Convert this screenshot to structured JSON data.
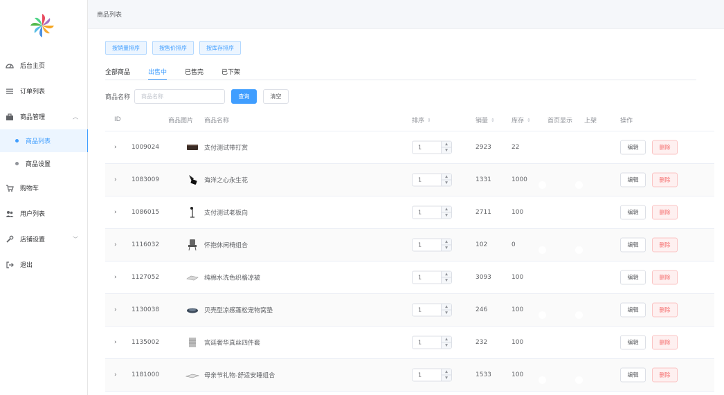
{
  "sidebar": {
    "items": [
      {
        "label": "后台主页",
        "icon": "dashboard-icon"
      },
      {
        "label": "订单列表",
        "icon": "list-icon"
      },
      {
        "label": "商品管理",
        "icon": "shop-icon"
      },
      {
        "label": "购物车",
        "icon": "cart-icon"
      },
      {
        "label": "用户列表",
        "icon": "users-icon"
      },
      {
        "label": "店铺设置",
        "icon": "wrench-icon"
      },
      {
        "label": "退出",
        "icon": "logout-icon"
      }
    ],
    "sub_items": [
      {
        "label": "商品列表",
        "active": true
      },
      {
        "label": "商品设置",
        "active": false
      }
    ]
  },
  "breadcrumb": "商品列表",
  "sort_buttons": [
    "按销量排序",
    "按售价排序",
    "按库存排序"
  ],
  "tabs": [
    "全部商品",
    "出售中",
    "已售完",
    "已下架"
  ],
  "active_tab": "出售中",
  "search": {
    "label": "商品名称",
    "placeholder": "商品名称",
    "query_label": "查询",
    "clear_label": "清空"
  },
  "table": {
    "headers": {
      "id": "ID",
      "image": "商品图片",
      "name": "商品名称",
      "sort": "排序",
      "sales": "销量",
      "stock": "库存",
      "home": "首页显示",
      "onsale": "上架",
      "actions": "操作"
    },
    "edit_label": "编辑",
    "delete_label": "删除",
    "rows": [
      {
        "id": "1009024",
        "name": "支付测试带打赏",
        "sort": "1",
        "sales": "2923",
        "stock": "22",
        "image": "box-image"
      },
      {
        "id": "1083009",
        "name": "海洋之心永生花",
        "sort": "1",
        "sales": "1331",
        "stock": "1000",
        "image": "flower-image"
      },
      {
        "id": "1086015",
        "name": "支付测试老板向",
        "sort": "1",
        "sales": "2711",
        "stock": "100",
        "image": "lamp-image"
      },
      {
        "id": "1116032",
        "name": "怀抱休闲椅组合",
        "sort": "1",
        "sales": "102",
        "stock": "0",
        "image": "chair-image"
      },
      {
        "id": "1127052",
        "name": "纯棉水洗色织格凉被",
        "sort": "1",
        "sales": "3093",
        "stock": "100",
        "image": "quilt-image"
      },
      {
        "id": "1130038",
        "name": "贝壳型凉感蓬松宠物窝垫",
        "sort": "1",
        "sales": "246",
        "stock": "100",
        "image": "petbed-image"
      },
      {
        "id": "1135002",
        "name": "宫廷奢华真丝四件套",
        "sort": "1",
        "sales": "232",
        "stock": "100",
        "image": "bedding-image"
      },
      {
        "id": "1181000",
        "name": "母亲节礼物-舒适安睡组合",
        "sort": "1",
        "sales": "1533",
        "stock": "100",
        "image": "pillow-image"
      }
    ]
  },
  "colors": {
    "primary": "#409eff",
    "danger": "#f56c6c",
    "sidebar_active_bg": "#ecf5ff"
  }
}
